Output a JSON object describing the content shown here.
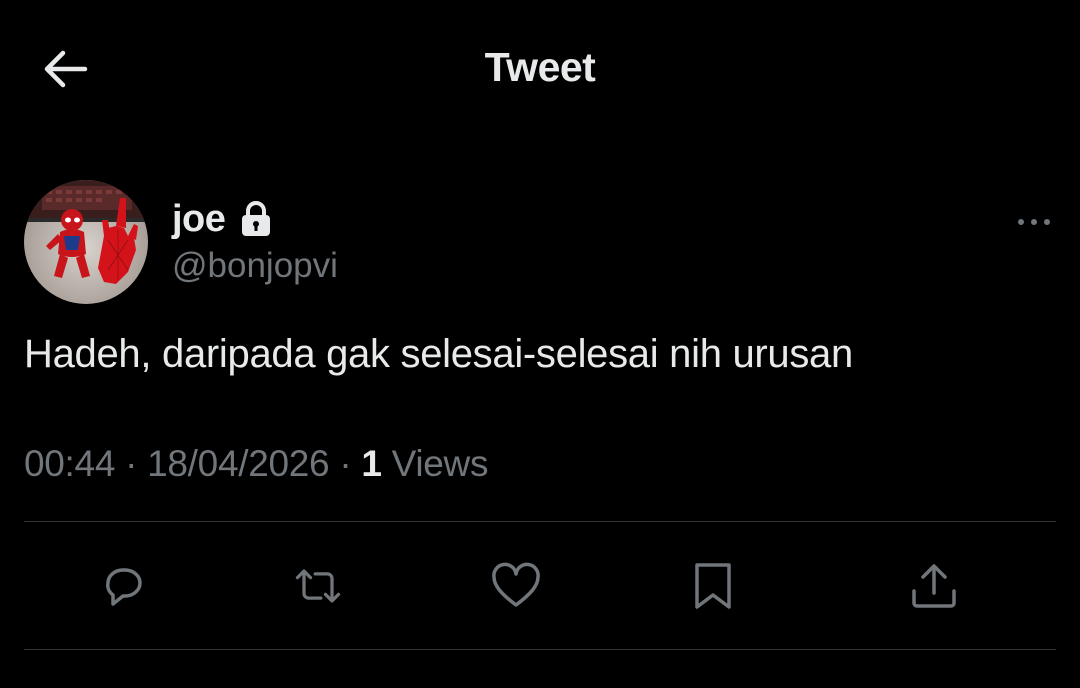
{
  "header": {
    "title": "Tweet",
    "back_icon": "arrow-left-icon"
  },
  "tweet": {
    "author": {
      "display_name": "joe",
      "handle": "@bonjopvi",
      "protected_icon": "lock-icon",
      "avatar": "spiderman-avatar"
    },
    "text": "Hadeh, daripada gak selesai-selesai nih urusan",
    "time": "00:44",
    "date": "18/04/2026",
    "separator": "·",
    "views_count": "1",
    "views_label": "Views"
  },
  "actions": {
    "reply_icon": "reply-icon",
    "retweet_icon": "retweet-icon",
    "like_icon": "heart-icon",
    "bookmark_icon": "bookmark-icon",
    "share_icon": "share-icon"
  },
  "colors": {
    "background": "#000000",
    "text_primary": "#e7e9ea",
    "text_secondary": "#71767b",
    "divider": "#2f3336"
  }
}
